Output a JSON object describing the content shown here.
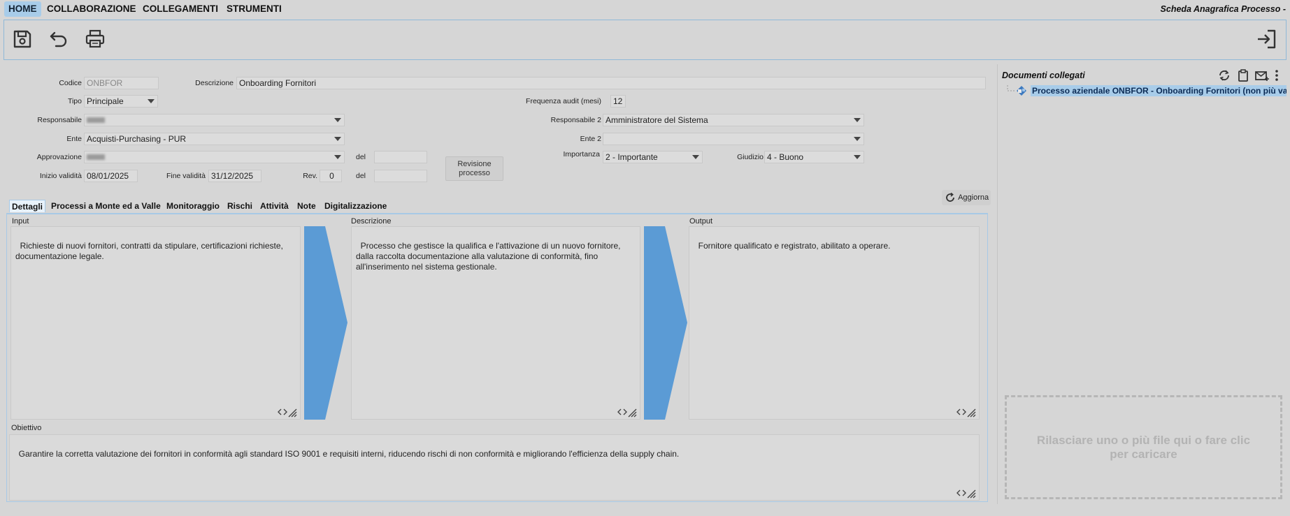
{
  "menu": {
    "items": [
      "HOME",
      "COLLABORAZIONE",
      "COLLEGAMENTI",
      "STRUMENTI"
    ],
    "active_index": 0,
    "window_title": "Scheda Anagrafica Processo -"
  },
  "toolbar": {
    "icons": [
      "save-icon",
      "undo-icon",
      "print-icon",
      "exit-icon"
    ]
  },
  "form": {
    "codice": {
      "label": "Codice",
      "value": "ONBFOR"
    },
    "descrizione": {
      "label": "Descrizione",
      "value": "Onboarding Fornitori"
    },
    "tipo": {
      "label": "Tipo",
      "value": "Principale"
    },
    "frequenza": {
      "label": "Frequenza audit (mesi)",
      "value": "12"
    },
    "responsabile": {
      "label": "Responsabile",
      "value": ""
    },
    "responsabile2": {
      "label": "Responsabile 2",
      "value": "Amministratore del Sistema"
    },
    "ente": {
      "label": "Ente",
      "value": "Acquisti-Purchasing - PUR"
    },
    "ente2": {
      "label": "Ente 2",
      "value": ""
    },
    "approvazione": {
      "label": "Approvazione",
      "value": "",
      "del_label": "del",
      "del_value": ""
    },
    "importanza": {
      "label": "Importanza",
      "value": "2 - Importante"
    },
    "giudizio": {
      "label": "Giudizio",
      "value": "4 - Buono"
    },
    "inizio": {
      "label": "Inizio validità",
      "value": "08/01/2025"
    },
    "fine": {
      "label": "Fine validità",
      "value": "31/12/2025"
    },
    "rev": {
      "label": "Rev.",
      "value": "0",
      "del_label": "del",
      "del_value": ""
    },
    "revisione_button": "Revisione processo"
  },
  "tabs": {
    "items": [
      "Dettagli",
      "Processi a Monte ed a Valle",
      "Monitoraggio",
      "Rischi",
      "Attività",
      "Note",
      "Digitalizzazione"
    ],
    "active_index": 0,
    "refresh_label": "Aggiorna"
  },
  "details": {
    "input": {
      "label": "Input",
      "text": "Richieste di nuovi fornitori, contratti da stipulare, certificazioni richieste,\ndocumentazione legale."
    },
    "descrizione": {
      "label": "Descrizione",
      "text": "Processo che gestisce la qualifica e l'attivazione di un nuovo fornitore,\ndalla raccolta documentazione alla valutazione di conformità, fino\nall'inserimento nel sistema gestionale."
    },
    "output": {
      "label": "Output",
      "text": "Fornitore qualificato e registrato, abilitato a operare."
    },
    "obiettivo": {
      "label": "Obiettivo",
      "text": "Garantire la corretta valutazione dei fornitori in conformità agli standard ISO 9001 e requisiti interni, riducendo rischi di non conformità e migliorando l'efficienza della supply chain."
    }
  },
  "documents": {
    "title": "Documenti collegati",
    "items": [
      "Processo aziendale ONBFOR - Onboarding Fornitori (non più valido d"
    ],
    "dropzone_text": "Rilasciare uno o più file qui o fare clic per caricare"
  },
  "colors": {
    "accent": "#a8cce9",
    "chevron": "#5b9bd5",
    "background": "#d6d6d6"
  }
}
